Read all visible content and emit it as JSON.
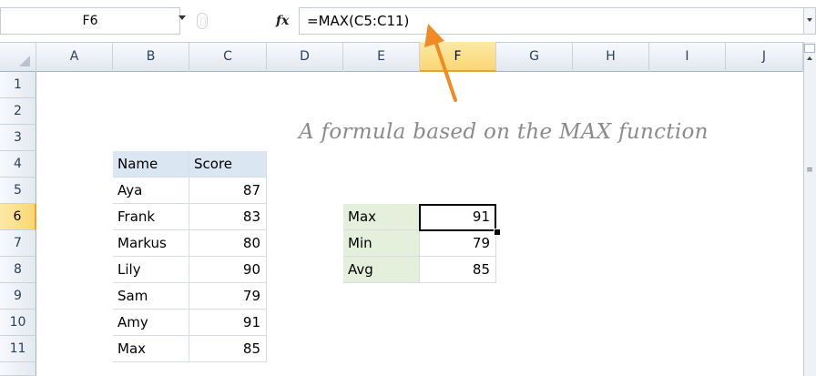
{
  "formula_bar": {
    "name_box": "F6",
    "fx_label": "fx",
    "formula": "=MAX(C5:C11)"
  },
  "columns": [
    "A",
    "B",
    "C",
    "D",
    "E",
    "F",
    "G",
    "H",
    "I",
    "J"
  ],
  "selected_column": "F",
  "rows": [
    "1",
    "2",
    "3",
    "4",
    "5",
    "6",
    "7",
    "8",
    "9",
    "10",
    "11"
  ],
  "selected_row": "6",
  "annotation": "A formula based on the MAX function",
  "table": {
    "headers": [
      "Name",
      "Score"
    ],
    "rows": [
      {
        "name": "Aya",
        "score": "87"
      },
      {
        "name": "Frank",
        "score": "83"
      },
      {
        "name": "Markus",
        "score": "80"
      },
      {
        "name": "Lily",
        "score": "90"
      },
      {
        "name": "Sam",
        "score": "79"
      },
      {
        "name": "Amy",
        "score": "91"
      },
      {
        "name": "Max",
        "score": "85"
      }
    ]
  },
  "summary": [
    {
      "label": "Max",
      "value": "91"
    },
    {
      "label": "Min",
      "value": "79"
    },
    {
      "label": "Avg",
      "value": "85"
    }
  ],
  "colors": {
    "header_fill": "#dbe6f3",
    "label_fill": "#e4efdc",
    "arrow": "#f08a24",
    "selection_highlight": "#f9d772"
  }
}
